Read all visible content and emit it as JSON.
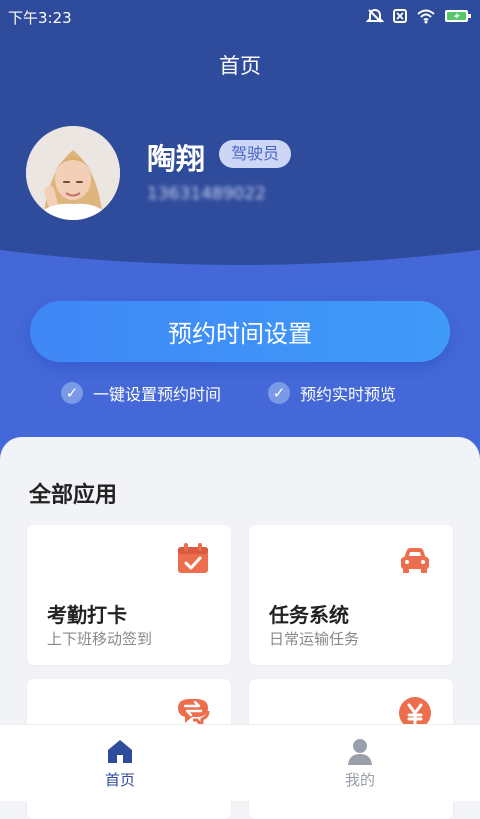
{
  "status_bar": {
    "time": "下午3:23"
  },
  "header": {
    "title": "首页"
  },
  "profile": {
    "name": "陶翔",
    "role": "驾驶员",
    "phone": "13631489022"
  },
  "main_action": {
    "label": "预约时间设置"
  },
  "features": [
    {
      "label": "一键设置预约时间"
    },
    {
      "label": "预约实时预览"
    }
  ],
  "apps": {
    "title": "全部应用",
    "items": [
      {
        "title": "考勤打卡",
        "subtitle": "上下班移动签到",
        "icon": "calendar-check-icon"
      },
      {
        "title": "任务系统",
        "subtitle": "日常运输任务",
        "icon": "car-icon"
      },
      {
        "title": "",
        "subtitle": "",
        "icon": "exchange-chat-icon"
      },
      {
        "title": "",
        "subtitle": "",
        "icon": "yuan-icon"
      }
    ]
  },
  "bottom_nav": [
    {
      "label": "首页",
      "icon": "home-icon",
      "active": true
    },
    {
      "label": "我的",
      "icon": "person-icon",
      "active": false
    }
  ],
  "colors": {
    "primary": "#4468d8",
    "button": "#3f87f6",
    "accent": "#ec6e4d",
    "active_nav": "#2f4b9c",
    "inactive_nav": "#9aa0ab"
  }
}
